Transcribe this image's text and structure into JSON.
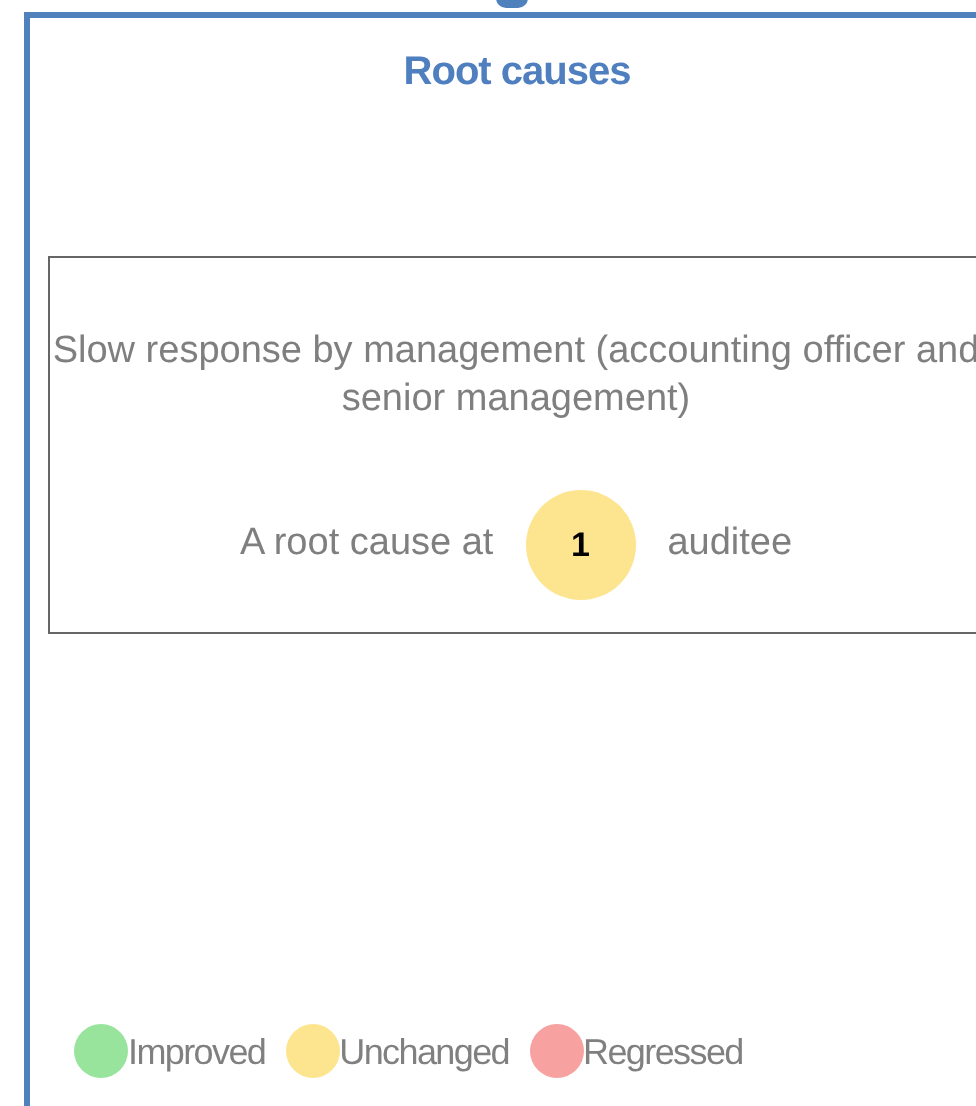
{
  "panel": {
    "title": "Root causes"
  },
  "causes": [
    {
      "description": "Slow response by management (accounting officer and senior management)",
      "count_prefix": "A root cause at",
      "count": "1",
      "count_suffix": "auditee",
      "color": "#fde590"
    }
  ],
  "legend": [
    {
      "label": "Improved",
      "color": "#98e49d"
    },
    {
      "label": "Unchanged",
      "color": "#fde590"
    },
    {
      "label": "Regressed",
      "color": "#f7a1a1"
    }
  ]
}
